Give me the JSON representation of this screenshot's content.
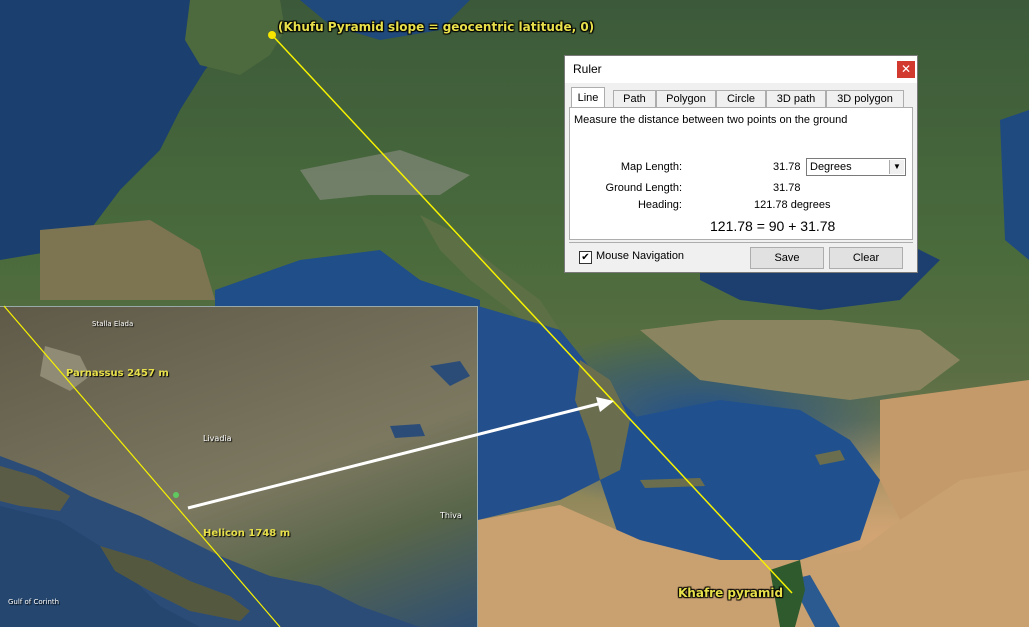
{
  "map": {
    "labels": {
      "khufu": "(Khufu Pyramid slope = geocentric latitude, 0)",
      "khafre": "Khafre pyramid"
    },
    "inset_labels": {
      "parnassus": "Parnassus 2457 m",
      "helicon": "Helicon 1748 m",
      "livadia": "Livadia",
      "thiva": "Thiva",
      "gulf": "Gulf of Corinth",
      "amfikleia": "Stalla Elada"
    },
    "colors": {
      "line": "#f7f200",
      "label": "#e8e04a",
      "arrow": "#ffffff"
    }
  },
  "ruler": {
    "title": "Ruler",
    "close_icon": "close-icon",
    "tabs": [
      "Line",
      "Path",
      "Polygon",
      "Circle",
      "3D path",
      "3D polygon"
    ],
    "active_tab": "Line",
    "description": "Measure the distance between two points on the ground",
    "map_length_label": "Map Length:",
    "map_length_value": "31.78",
    "unit_selected": "Degrees",
    "ground_length_label": "Ground Length:",
    "ground_length_value": "31.78",
    "heading_label": "Heading:",
    "heading_value": "121.78 degrees",
    "equation": "121.78 = 90 + 31.78",
    "mouse_navigation_label": "Mouse Navigation",
    "mouse_navigation_checked": true,
    "save_label": "Save",
    "clear_label": "Clear"
  }
}
